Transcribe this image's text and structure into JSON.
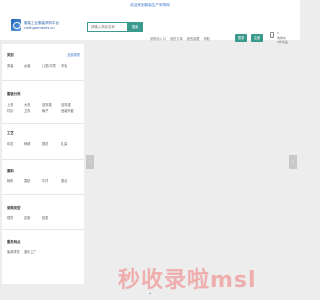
{
  "topbar": {
    "text": "欢迎来到服装生产采购网"
  },
  "brand": {
    "name_cn": "服装工业服装采购平台",
    "name_en": "clothgarments.cn"
  },
  "search": {
    "placeholder": "请输入商品名称",
    "button": "搜索"
  },
  "header_links": [
    "采购商入口",
    "我的订单",
    "我的收藏",
    "帮助"
  ],
  "auth": {
    "login": "登录",
    "register": "注册"
  },
  "cart": {
    "lines": [
      "0",
      "购物车",
      "0件商品"
    ]
  },
  "sidebar": {
    "sections": [
      {
        "title": "类别",
        "link": "全部类别",
        "items": [
          "男装",
          "女装",
          "儿童/中童",
          "羊毛"
        ]
      },
      {
        "title": "服装分类",
        "items": [
          "上衣",
          "大衣",
          "连衣裙",
          "连衣裙",
          "衬衫",
          "卫衣",
          "裤子",
          "西装外套"
        ]
      },
      {
        "title": "工艺",
        "items": [
          "印花",
          "刺绣",
          "提花",
          "扎染"
        ]
      },
      {
        "title": "面料",
        "items": [
          "棉布",
          "雪纺",
          "牛仔",
          "蕾丝"
        ]
      },
      {
        "title": "采购类型",
        "items": [
          "现货",
          "定制",
          "批发"
        ]
      },
      {
        "title": "服务特点",
        "items": [
          "免费样衣",
          "源头工厂"
        ]
      }
    ]
  },
  "carousel": {
    "prev": "‹",
    "next": "›"
  },
  "watermark": {
    "text": "秒收录啦msl"
  },
  "footer": {
    "arrow": "⌄"
  },
  "colors": {
    "accent": "#3b9a8e",
    "link": "#3a76c6",
    "watermark": "#f0a8a8"
  }
}
